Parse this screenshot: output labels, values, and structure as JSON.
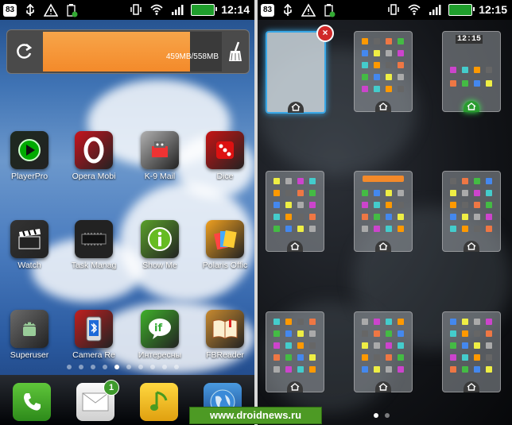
{
  "left": {
    "status": {
      "badge": "83",
      "time": "12:14"
    },
    "memory_widget": {
      "text": "459MB/558MB",
      "used_fraction": 0.82
    },
    "apps": [
      {
        "label": "PlayerPro",
        "icon": "play-icon",
        "color": "#1e2a20"
      },
      {
        "label": "Opera Mobi",
        "icon": "opera-icon",
        "color": "#c8141e"
      },
      {
        "label": "K-9 Mail",
        "icon": "mail-robot-icon",
        "color": "#b0b0b0"
      },
      {
        "label": "Dice",
        "icon": "dice-icon",
        "color": "#c81414"
      },
      {
        "label": "Watch",
        "icon": "clapper-icon",
        "color": "#333333"
      },
      {
        "label": "Task Manag",
        "icon": "chip-icon",
        "color": "#222222"
      },
      {
        "label": "Show Me",
        "icon": "info-icon",
        "color": "#5aa02a"
      },
      {
        "label": "Polaris Offic",
        "icon": "documents-icon",
        "color": "#f0a020"
      },
      {
        "label": "Superuser",
        "icon": "android-icon",
        "color": "#6a6a6a"
      },
      {
        "label": "Camera Re",
        "icon": "bluetooth-phone-icon",
        "color": "#c02020"
      },
      {
        "label": "Интересны",
        "icon": "if-icon",
        "color": "#3fb02a"
      },
      {
        "label": "FBReader",
        "icon": "book-icon",
        "color": "#c88a30"
      }
    ],
    "page_dots_count": 10,
    "page_dot_active": 4,
    "dock": [
      {
        "name": "phone",
        "icon": "phone-icon",
        "color": "#3fa82a"
      },
      {
        "name": "mail",
        "icon": "envelope-icon",
        "color": "#e8e8e8",
        "badge": "1"
      },
      {
        "name": "music",
        "icon": "music-icon",
        "color": "#f0c020"
      },
      {
        "name": "globe",
        "icon": "globe-icon",
        "color": "#2a6ab0"
      }
    ]
  },
  "right": {
    "status": {
      "badge": "83",
      "time": "12:15"
    },
    "thumb_clock": "12:15",
    "screens": [
      {
        "type": "empty",
        "selected": true,
        "deletable": true
      },
      {
        "type": "apps",
        "home_active": false
      },
      {
        "type": "clock",
        "home_active": true
      },
      {
        "type": "apps"
      },
      {
        "type": "widget-apps"
      },
      {
        "type": "apps"
      },
      {
        "type": "apps"
      },
      {
        "type": "apps"
      },
      {
        "type": "apps"
      }
    ],
    "page_dots_count": 2,
    "page_dot_active": 0
  },
  "watermark": "www.droidnews.ru"
}
